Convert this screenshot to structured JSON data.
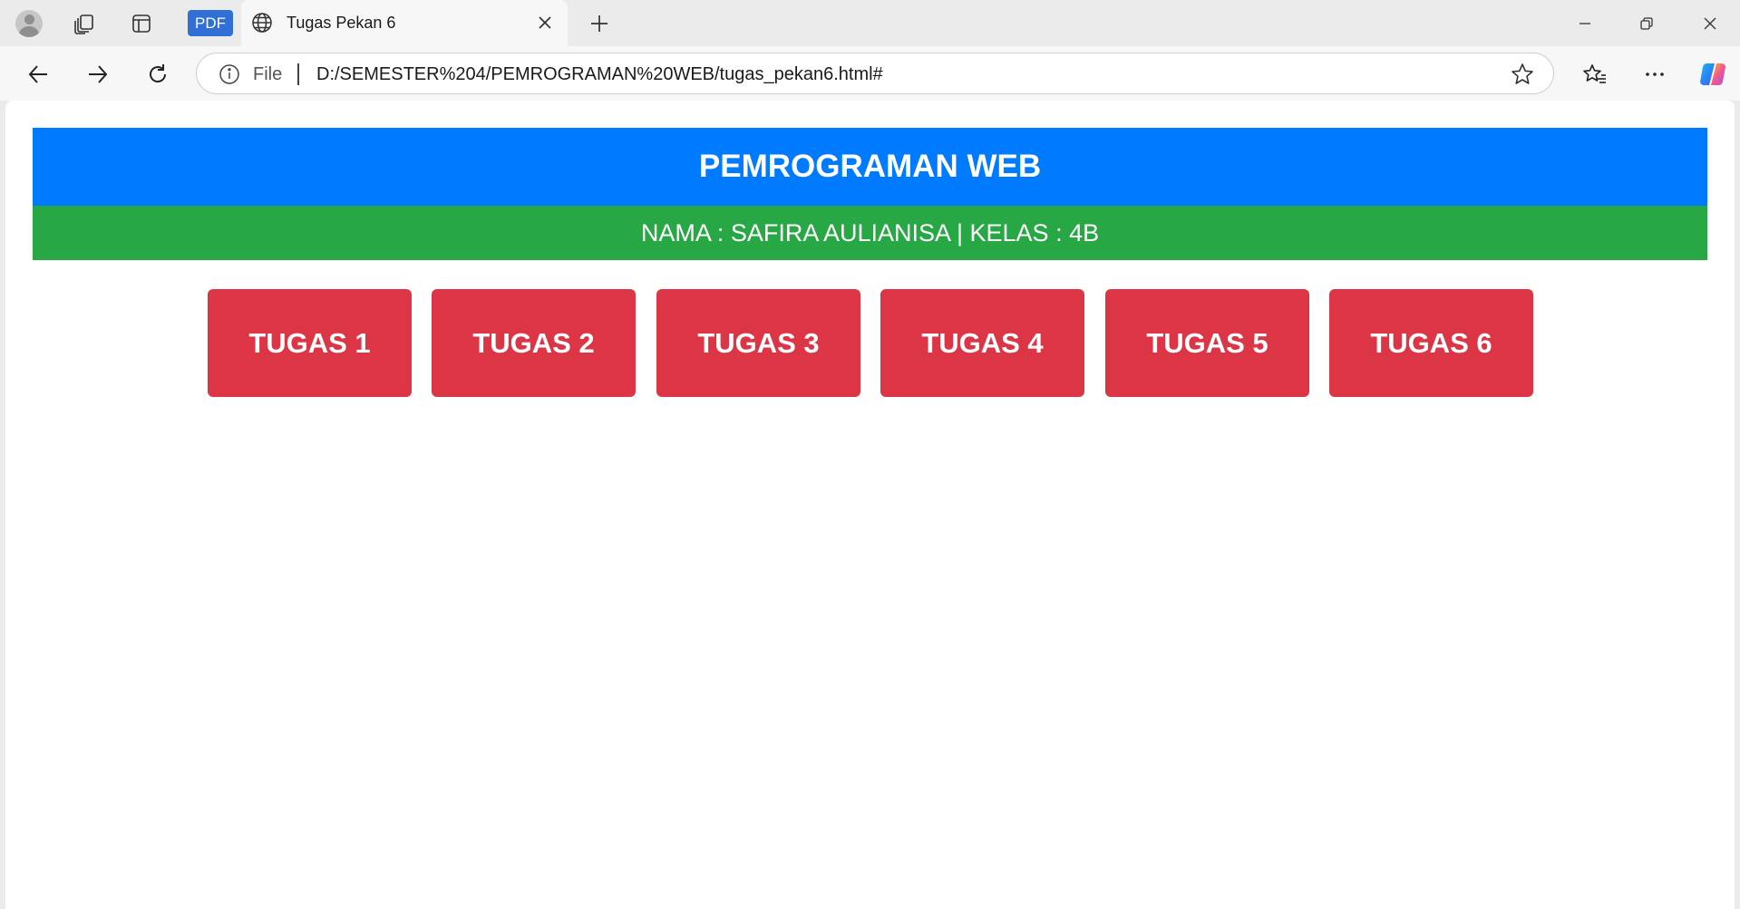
{
  "browser": {
    "tab": {
      "pdf_badge": "PDF",
      "title": "Tugas Pekan 6"
    },
    "address_bar": {
      "scheme_label": "File",
      "url": "D:/SEMESTER%204/PEMROGRAMAN%20WEB/tugas_pekan6.html#"
    },
    "icons": {
      "profile": "avatar-icon",
      "workspaces": "workspaces-icon",
      "tab_actions": "tab-actions-icon",
      "globe": "globe-icon",
      "close_tab": "close-icon",
      "new_tab": "plus-icon",
      "back": "back-arrow-icon",
      "forward": "forward-arrow-icon",
      "refresh": "refresh-icon",
      "site_info": "info-icon",
      "favorite": "star-icon",
      "favorites": "favorites-icon",
      "more": "more-icon",
      "copilot": "copilot-icon"
    }
  },
  "page": {
    "title": "PEMROGRAMAN WEB",
    "subtitle": "NAMA : SAFIRA AULIANISA | KELAS : 4B",
    "buttons": [
      {
        "label": "TUGAS 1"
      },
      {
        "label": "TUGAS 2"
      },
      {
        "label": "TUGAS 3"
      },
      {
        "label": "TUGAS 4"
      },
      {
        "label": "TUGAS 5"
      },
      {
        "label": "TUGAS 6"
      }
    ],
    "colors": {
      "header_blue": "#007bff",
      "header_green": "#28a745",
      "button_red": "#dc3545"
    }
  }
}
